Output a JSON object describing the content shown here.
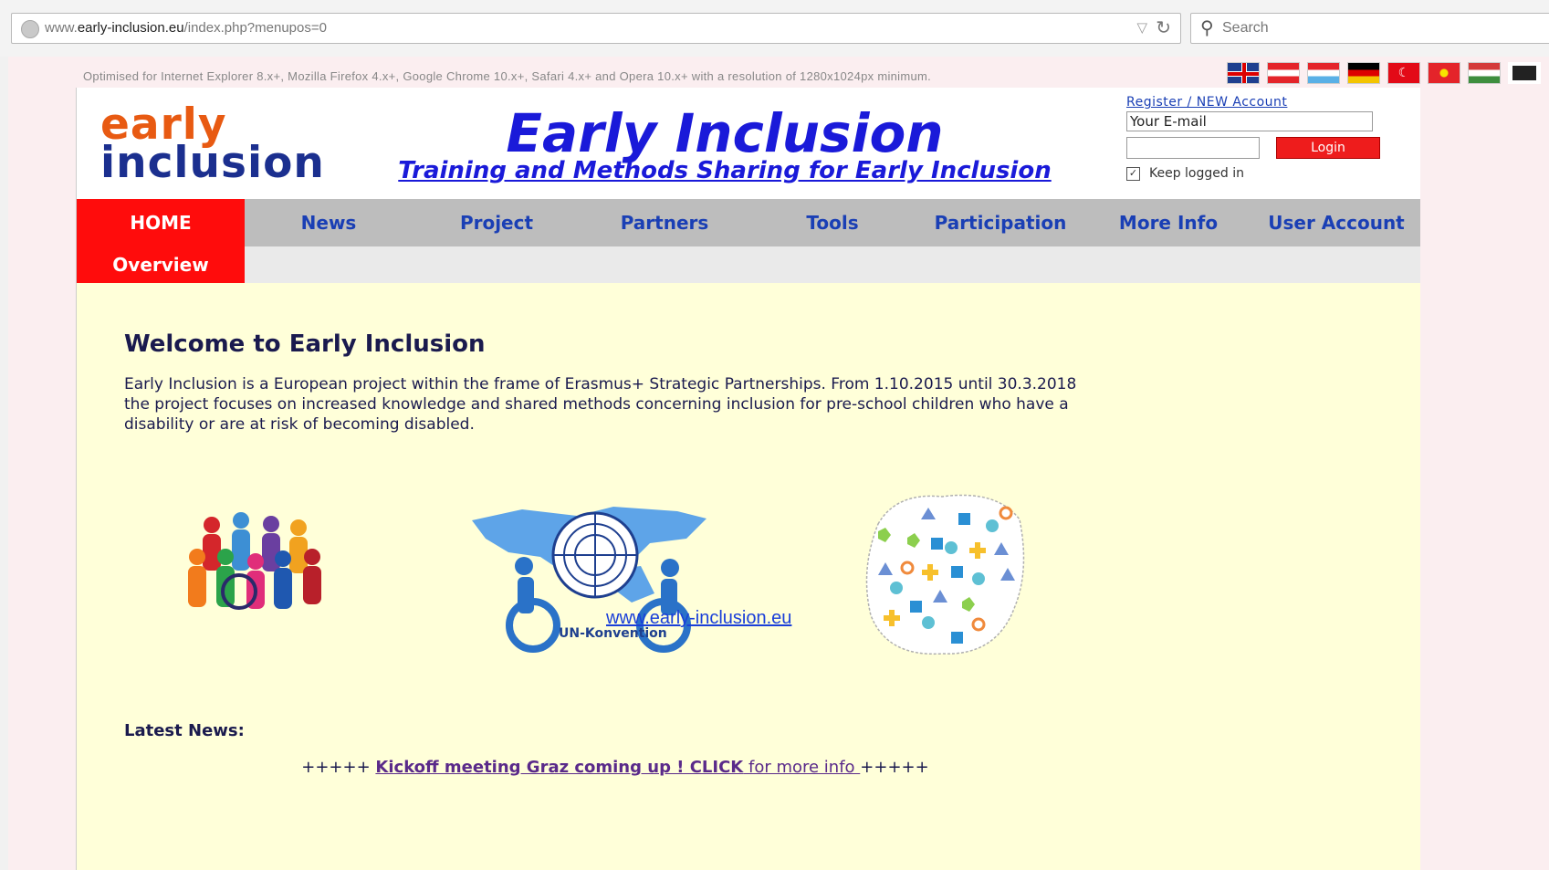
{
  "browser": {
    "url_prefix": "www.",
    "url_domain": "early-inclusion.eu",
    "url_path": "/index.php?menupos=0",
    "search_placeholder": "Search"
  },
  "top_note": "Optimised for Internet Explorer 8.x+, Mozilla Firefox 4.x+, Google Chrome 10.x+, Safari 4.x+ and Opera 10.x+ with a resolution of 1280x1024px minimum.",
  "languages": [
    "uk-flag-icon",
    "austria-flag-icon",
    "luxembourg-flag-icon",
    "germany-flag-icon",
    "turkey-flag-icon",
    "macedonia-flag-icon",
    "hungary-flag-icon",
    "display-settings-icon"
  ],
  "header": {
    "logo_line1": "early",
    "logo_line2": "inclusion",
    "title": "Early Inclusion",
    "subtitle": "Training and Methods Sharing for Early Inclusion"
  },
  "login": {
    "register_link": "Register / NEW Account",
    "email_value": "Your E-mail",
    "login_button": "Login",
    "keep_logged": "Keep logged in",
    "keep_checked": "✓"
  },
  "nav": {
    "items": [
      "HOME",
      "News",
      "Project",
      "Partners",
      "Tools",
      "Participation",
      "More Info",
      "User Account"
    ],
    "sub_overview": "Overview"
  },
  "content": {
    "welcome_title": "Welcome to Early Inclusion",
    "intro": "Early Inclusion is a European project within the frame of Erasmus+ Strategic Partnerships. From 1.10.2015 until 30.3.2018 the project focuses on increased knowledge and shared methods concerning inclusion for pre-school children who have a disability or are at risk of becoming disabled.",
    "un_label": "UN-Konvention",
    "overlay_link": "www.early-inclusion.eu",
    "latest_news": "Latest News:",
    "ticker_pre": "+++++ ",
    "ticker_link": "Kickoff meeting Graz coming up ! CLICK",
    "ticker_more": " for more info ",
    "ticker_post": "+++++"
  },
  "colors": {
    "nav_active": "#ff0c0c",
    "nav_bg": "#bdbdbd",
    "title_blue": "#1a1ad9",
    "content_bg": "#ffffd9",
    "logo_orange": "#e85a12",
    "logo_blue": "#1b2f8f"
  }
}
